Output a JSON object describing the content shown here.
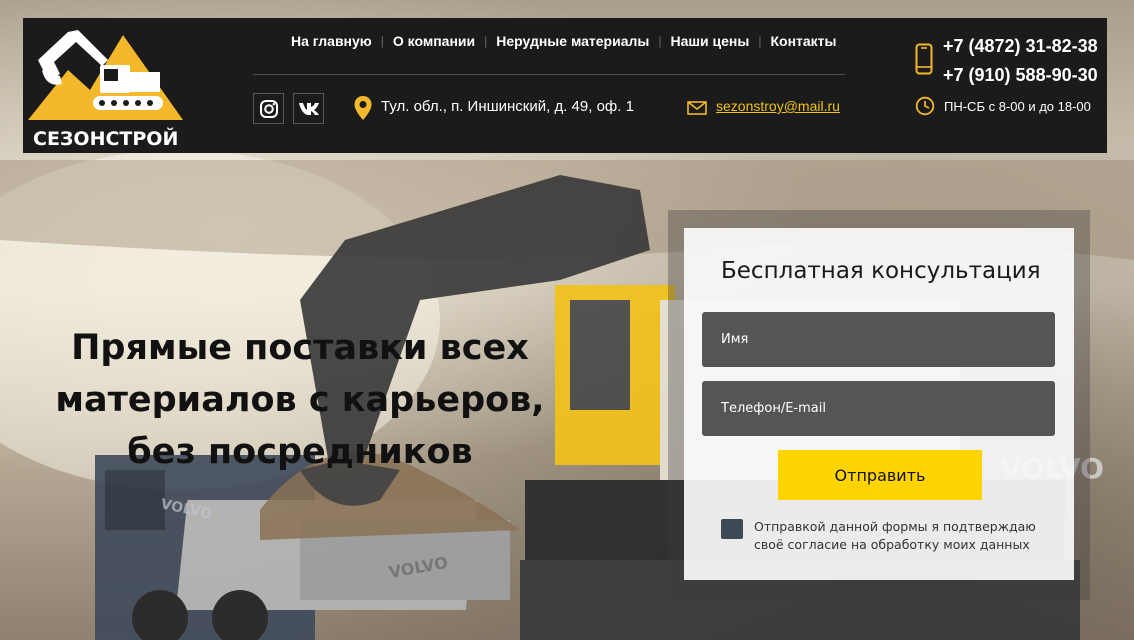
{
  "brand": {
    "name": "СЕЗОНСТРОЙ",
    "accent": "#f3b82b",
    "logo_icon": "excavator-icon"
  },
  "nav": {
    "items": [
      {
        "label": "На главную"
      },
      {
        "label": "О компании"
      },
      {
        "label": "Нерудные материалы"
      },
      {
        "label": "Наши цены"
      },
      {
        "label": "Контакты"
      }
    ],
    "separator": "|"
  },
  "social": {
    "instagram_icon": "instagram-icon",
    "vk_icon": "vk-icon"
  },
  "contacts": {
    "address": "Тул. обл., п. Иншинский, д. 49, оф. 1",
    "email": "sezonstroy@mail.ru",
    "phones": [
      "+7 (4872) 31-82-38",
      "+7 (910) 588-90-30"
    ],
    "hours": "ПН-СБ с 8-00 и до 18-00"
  },
  "hero": {
    "line1": "Прямые поставки всех",
    "line2": "материалов с карьеров,",
    "line3": "без посредников"
  },
  "form": {
    "title": "Бесплатная консультация",
    "name_placeholder": "Имя",
    "contact_placeholder": "Телефон/E-mail",
    "submit_label": "Отправить",
    "consent": "Отправкой данной формы я подтверждаю своё согласие на обработку моих данных"
  },
  "colors": {
    "header_bg": "#1b1b1b",
    "submit_bg": "#ffd400",
    "field_bg": "#555555",
    "email_link": "#f1c40f"
  }
}
